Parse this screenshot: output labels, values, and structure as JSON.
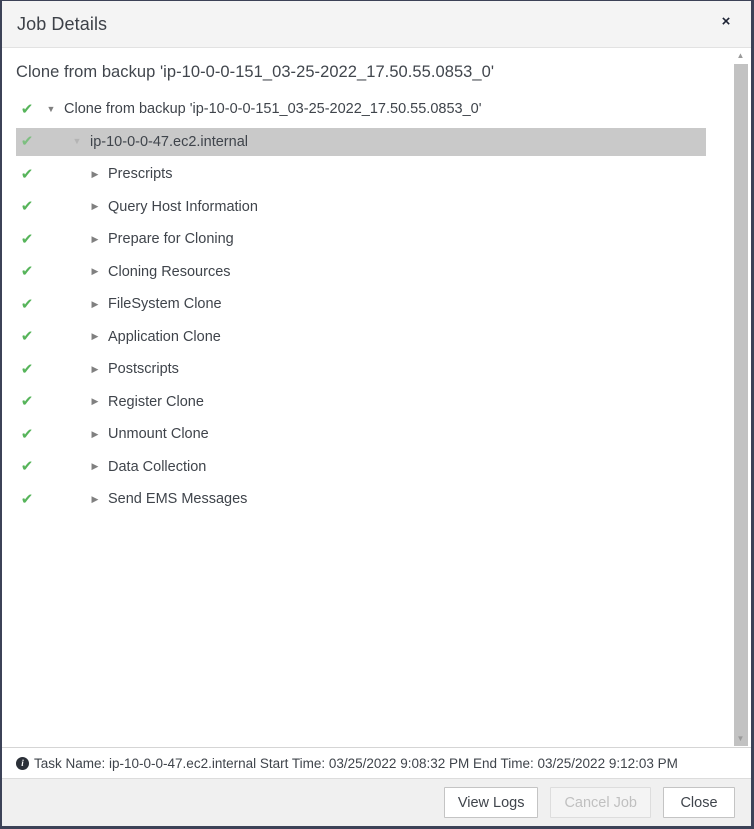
{
  "window": {
    "title": "Job Details",
    "close_label": "×",
    "close_icon": "close-icon"
  },
  "main": {
    "subtitle": "Clone from backup 'ip-10-0-0-151_03-25-2022_17.50.55.0853_0'",
    "tree": [
      {
        "label": "Clone from backup 'ip-10-0-0-151_03-25-2022_17.50.55.0853_0'",
        "level": 0,
        "expanded": true,
        "status": "success",
        "status_icon": "check-icon",
        "toggle_icon": "caret-down-icon",
        "selected": false
      },
      {
        "label": "ip-10-0-0-47.ec2.internal",
        "level": 1,
        "expanded": true,
        "status": "success",
        "status_icon": "check-icon",
        "toggle_icon": "caret-down-icon",
        "selected": true
      },
      {
        "label": "Prescripts",
        "level": 2,
        "expanded": false,
        "status": "success",
        "status_icon": "check-icon",
        "toggle_icon": "caret-right-icon",
        "selected": false
      },
      {
        "label": "Query Host Information",
        "level": 2,
        "expanded": false,
        "status": "success",
        "status_icon": "check-icon",
        "toggle_icon": "caret-right-icon",
        "selected": false
      },
      {
        "label": "Prepare for Cloning",
        "level": 2,
        "expanded": false,
        "status": "success",
        "status_icon": "check-icon",
        "toggle_icon": "caret-right-icon",
        "selected": false
      },
      {
        "label": "Cloning Resources",
        "level": 2,
        "expanded": false,
        "status": "success",
        "status_icon": "check-icon",
        "toggle_icon": "caret-right-icon",
        "selected": false
      },
      {
        "label": "FileSystem Clone",
        "level": 2,
        "expanded": false,
        "status": "success",
        "status_icon": "check-icon",
        "toggle_icon": "caret-right-icon",
        "selected": false
      },
      {
        "label": "Application Clone",
        "level": 2,
        "expanded": false,
        "status": "success",
        "status_icon": "check-icon",
        "toggle_icon": "caret-right-icon",
        "selected": false
      },
      {
        "label": "Postscripts",
        "level": 2,
        "expanded": false,
        "status": "success",
        "status_icon": "check-icon",
        "toggle_icon": "caret-right-icon",
        "selected": false
      },
      {
        "label": "Register Clone",
        "level": 2,
        "expanded": false,
        "status": "success",
        "status_icon": "check-icon",
        "toggle_icon": "caret-right-icon",
        "selected": false
      },
      {
        "label": "Unmount Clone",
        "level": 2,
        "expanded": false,
        "status": "success",
        "status_icon": "check-icon",
        "toggle_icon": "caret-right-icon",
        "selected": false
      },
      {
        "label": "Data Collection",
        "level": 2,
        "expanded": false,
        "status": "success",
        "status_icon": "check-icon",
        "toggle_icon": "caret-right-icon",
        "selected": false
      },
      {
        "label": "Send EMS Messages",
        "level": 2,
        "expanded": false,
        "status": "success",
        "status_icon": "check-icon",
        "toggle_icon": "caret-right-icon",
        "selected": false
      }
    ]
  },
  "scrollbar": {
    "up_arrow": "▲",
    "down_arrow": "▼"
  },
  "infobar": {
    "icon": "info-icon",
    "icon_glyph": "i",
    "text": "Task Name: ip-10-0-0-47.ec2.internal Start Time: 03/25/2022 9:08:32 PM End Time: 03/25/2022 9:12:03 PM"
  },
  "footer": {
    "buttons": [
      {
        "label": "View Logs",
        "name": "view-logs-button",
        "disabled": false
      },
      {
        "label": "Cancel Job",
        "name": "cancel-job-button",
        "disabled": true
      },
      {
        "label": "Close",
        "name": "close-button",
        "disabled": false
      }
    ]
  },
  "colors": {
    "success_check": "#56b45a",
    "selected_row": "#c9c9c9",
    "window_border": "#3c4257",
    "titlebar_bg": "#f4f4f4",
    "footer_bg": "#f0f0f0"
  },
  "glyphs": {
    "check": "✔",
    "caret_down": "▼",
    "caret_right": "▶"
  }
}
